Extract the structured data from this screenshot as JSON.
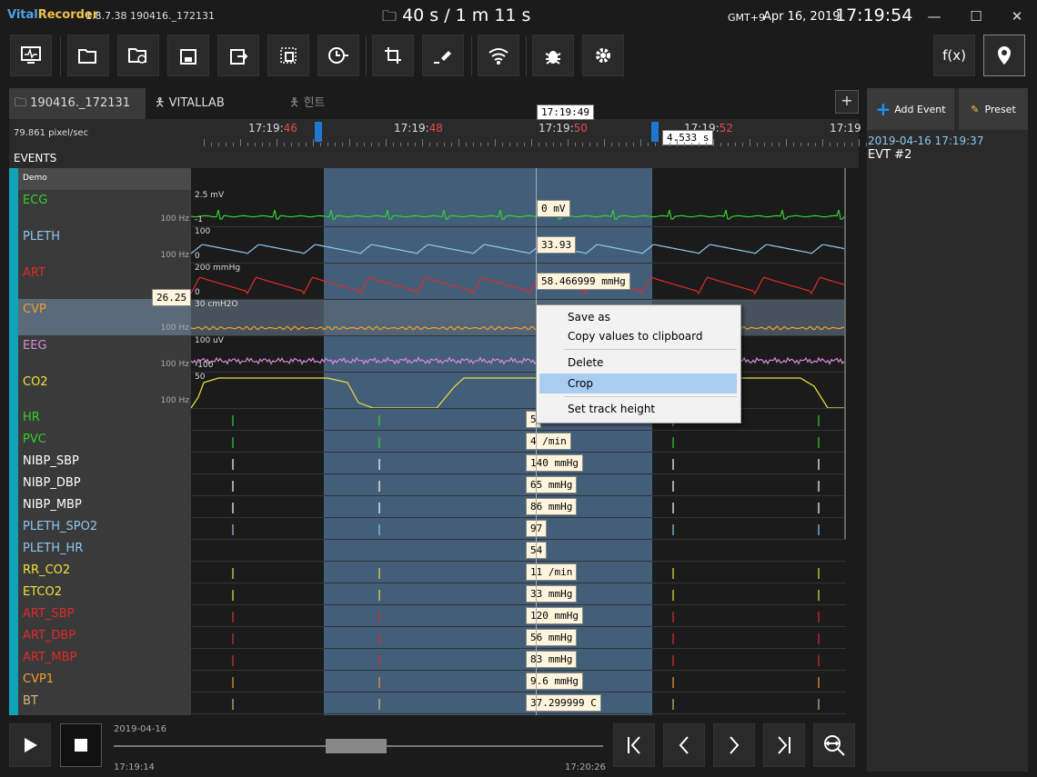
{
  "app": {
    "brand_a": "Vital",
    "brand_b": "Recorder",
    "version": "1.8.7.38 190416._172131"
  },
  "title": {
    "duration": "40 s / 1 m 11 s",
    "timezone": "GMT+9",
    "date": "Apr 16, 2019",
    "time": "17:19:54"
  },
  "window": {
    "minimize": "—",
    "maximize": "☐",
    "close": "✕"
  },
  "toolbar": {
    "func_label": "f(x)"
  },
  "tabs": [
    {
      "label": "190416._172131"
    },
    {
      "label": "VITALLAB"
    },
    {
      "label": "힌트"
    }
  ],
  "ruler": {
    "speed": "79.861 pixel/sec",
    "labels": [
      {
        "hm": "17:19:",
        "s": "46"
      },
      {
        "hm": "17:19:",
        "s": "48"
      },
      {
        "hm": "17:19:",
        "s": "50"
      },
      {
        "hm": "17:19:",
        "s": "52"
      },
      {
        "hm": "17:19",
        "s": ""
      }
    ],
    "cursor_time": "17:19:49",
    "selection_length": "4.533 s"
  },
  "events_label": "EVENTS",
  "demo_label": "Demo",
  "waves": [
    {
      "name": "ECG",
      "color": "#2fd12f",
      "hz": "100 Hz",
      "scale_top": "2.5 mV",
      "scale_bottom": "-1",
      "value": "0 mV"
    },
    {
      "name": "PLETH",
      "color": "#8ec8f0",
      "hz": "100 Hz",
      "scale_top": "100",
      "scale_bottom": "0",
      "value": "33.93"
    },
    {
      "name": "ART",
      "color": "#e02a2a",
      "hz": "",
      "scale_top": "200 mmHg",
      "scale_bottom": "0",
      "value": "58.466999 mmHg"
    },
    {
      "name": "CVP",
      "color": "#f0a030",
      "hz": "100 Hz",
      "scale_top": "30 cmH2O",
      "scale_bottom": "",
      "value": "26.25"
    },
    {
      "name": "EEG",
      "color": "#d88ad8",
      "hz": "100 Hz",
      "scale_top": "100 uV",
      "scale_bottom": "-100",
      "value": ""
    },
    {
      "name": "CO2",
      "color": "#f0e040",
      "hz": "100 Hz",
      "scale_top": "50",
      "scale_bottom": "",
      "value": ""
    }
  ],
  "numerics": [
    {
      "name": "HR",
      "color": "#2fd12f",
      "value": "5"
    },
    {
      "name": "PVC",
      "color": "#2fd12f",
      "value": "4 /min"
    },
    {
      "name": "NIBP_SBP",
      "color": "#ffffff",
      "value": "140 mmHg"
    },
    {
      "name": "NIBP_DBP",
      "color": "#ffffff",
      "value": "65 mmHg"
    },
    {
      "name": "NIBP_MBP",
      "color": "#ffffff",
      "value": "86 mmHg"
    },
    {
      "name": "PLETH_SPO2",
      "color": "#8ec8f0",
      "value": "97"
    },
    {
      "name": "PLETH_HR",
      "color": "#8ec8f0",
      "value": "54"
    },
    {
      "name": "RR_CO2",
      "color": "#f0e040",
      "value": "11 /min"
    },
    {
      "name": "ETCO2",
      "color": "#f0e040",
      "value": "33 mmHg"
    },
    {
      "name": "ART_SBP",
      "color": "#e02a2a",
      "value": "120 mmHg"
    },
    {
      "name": "ART_DBP",
      "color": "#e02a2a",
      "value": "56 mmHg"
    },
    {
      "name": "ART_MBP",
      "color": "#e02a2a",
      "value": "83 mmHg"
    },
    {
      "name": "CVP1",
      "color": "#f0a030",
      "value": "9.6 mmHg"
    },
    {
      "name": "BT",
      "color": "#d8b880",
      "value": "37.299999 C"
    }
  ],
  "context_menu": {
    "items": [
      "Save as",
      "Copy values to clipboard",
      "Delete",
      "Crop",
      "Set track height"
    ],
    "highlighted": "Crop"
  },
  "bottom": {
    "date": "2019-04-16",
    "start": "17:19:14",
    "end": "17:20:26"
  },
  "right_panel": {
    "add_event": "Add Event",
    "preset": "Preset",
    "event_time": "2019-04-16 17:19:37",
    "event_name": "EVT #2"
  },
  "colors": {
    "accent": "#1e78d0",
    "stripe": "#10a3b8",
    "selection": "#4a6a8a"
  }
}
